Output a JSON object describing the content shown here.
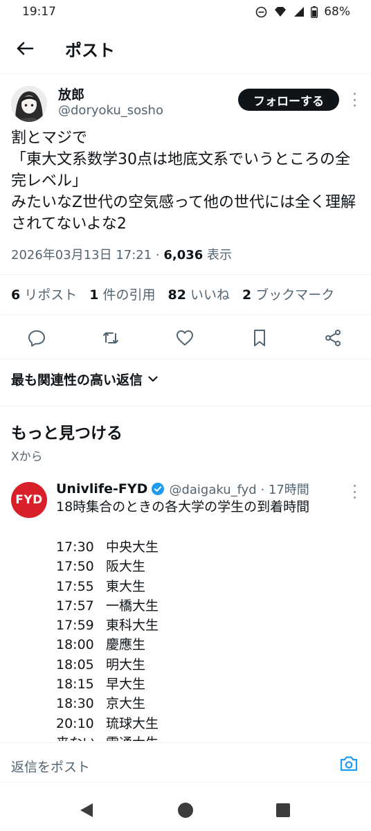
{
  "status_bar": {
    "time": "19:17",
    "battery": "68%"
  },
  "header": {
    "title": "ポスト"
  },
  "post": {
    "author_name": "放郎",
    "author_handle": "@doryoku_sosho",
    "follow_label": "フォローする",
    "body": "割とマジで\n「東大文系数学30点は地底文系でいうところの全完レベル」\nみたいなZ世代の空気感って他の世代には全く理解されてないよな2",
    "timestamp": "2026年03月13日 17:21 · ",
    "views_count": "6,036",
    "views_label": " 表示"
  },
  "stats": [
    {
      "count": "6",
      "label": "リポスト"
    },
    {
      "count": "1",
      "label": "件の引用"
    },
    {
      "count": "82",
      "label": "いいね"
    },
    {
      "count": "2",
      "label": "ブックマーク"
    }
  ],
  "actions": [
    "reply-icon",
    "repost-icon",
    "like-icon",
    "bookmark-icon",
    "share-icon"
  ],
  "replies_filter": {
    "label": "最も関連性の高い返信"
  },
  "discover": {
    "title": "もっと見つける",
    "subtitle": "Xから",
    "card": {
      "avatar_text": "FYD",
      "name": "Univlife-FYD",
      "handle": "@daigaku_fyd · 17時間",
      "text": "18時集合のときの各大学の学生の到着時間",
      "arrivals": [
        {
          "time": "17:30",
          "school": "中央大生"
        },
        {
          "time": "17:50",
          "school": "阪大生"
        },
        {
          "time": "17:55",
          "school": "東大生"
        },
        {
          "time": "17:57",
          "school": "一橋大生"
        },
        {
          "time": "17:59",
          "school": "東科大生"
        },
        {
          "time": "18:00",
          "school": "慶應生"
        },
        {
          "time": "18:05",
          "school": "明大生"
        },
        {
          "time": "18:15",
          "school": "早大生"
        },
        {
          "time": "18:30",
          "school": "京大生"
        },
        {
          "time": "20:10",
          "school": "琉球大生"
        },
        {
          "time": "来ない",
          "school": "電通大生"
        }
      ]
    }
  },
  "reply_bar": {
    "placeholder": "返信をポスト"
  },
  "colors": {
    "accent": "#1d9bf0",
    "text": "#0f1419",
    "secondary": "#536471",
    "fyd_red": "#d8202a"
  }
}
